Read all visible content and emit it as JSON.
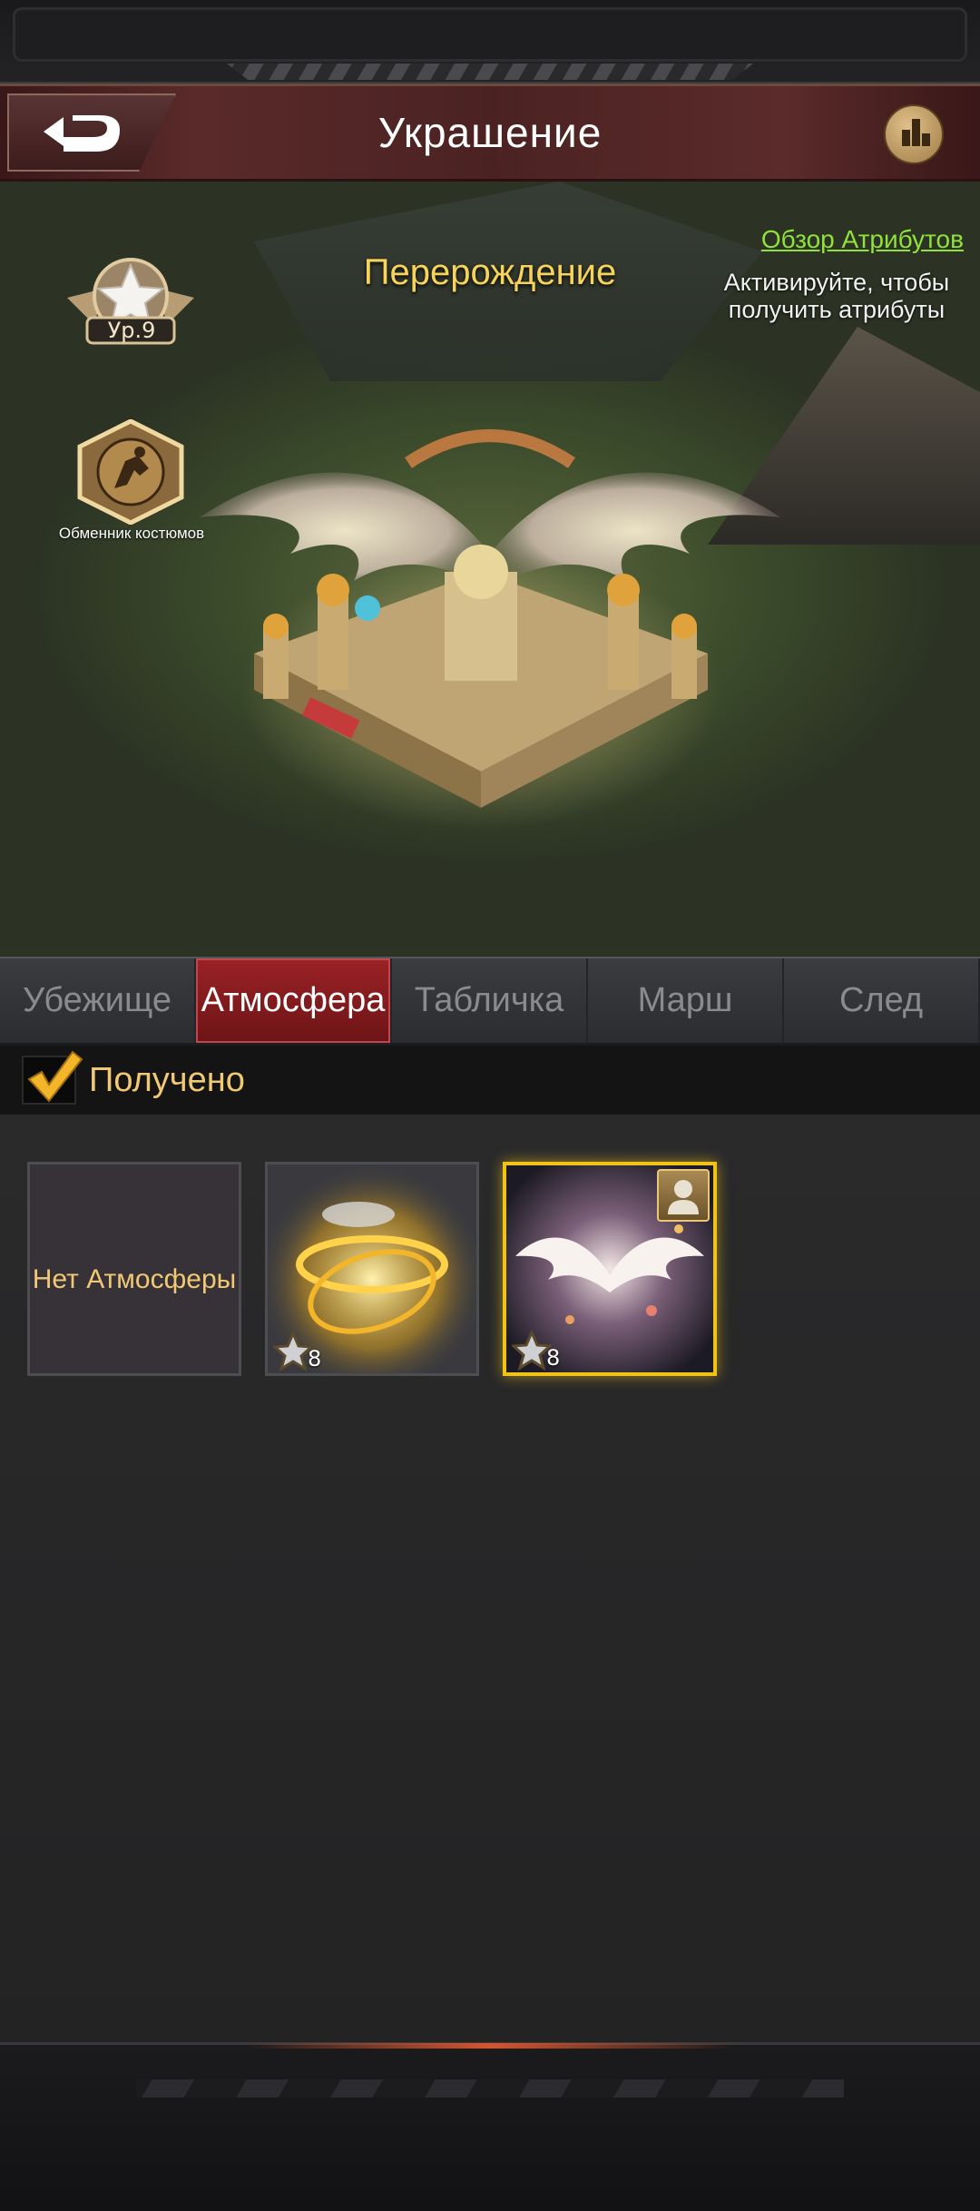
{
  "header": {
    "title": "Украшение"
  },
  "scene": {
    "rebirth_label": "Перерождение",
    "attributes_link": "Обзор Атрибутов",
    "attributes_hint": "Активируйте, чтобы получить атрибуты",
    "level_label": "Ур.9",
    "costume_exchange_label": "Обменник костюмов"
  },
  "tabs": [
    {
      "label": "Убежище",
      "active": false
    },
    {
      "label": "Атмосфера",
      "active": true
    },
    {
      "label": "Табличка",
      "active": false
    },
    {
      "label": "Марш",
      "active": false
    },
    {
      "label": "След",
      "active": false
    }
  ],
  "filter": {
    "received_label": "Получено",
    "checked": true
  },
  "items": [
    {
      "label": "Нет Атмосферы"
    },
    {
      "stars": "8",
      "icon": "golden-swirl-aura"
    },
    {
      "stars": "8",
      "icon": "angel-wings-aura",
      "selected": true,
      "badge": "user-icon"
    }
  ],
  "colors": {
    "accent_red": "#9a2226",
    "gold": "#f1c317",
    "link_green": "#8fe13c",
    "title_yellow": "#f6d45a"
  }
}
